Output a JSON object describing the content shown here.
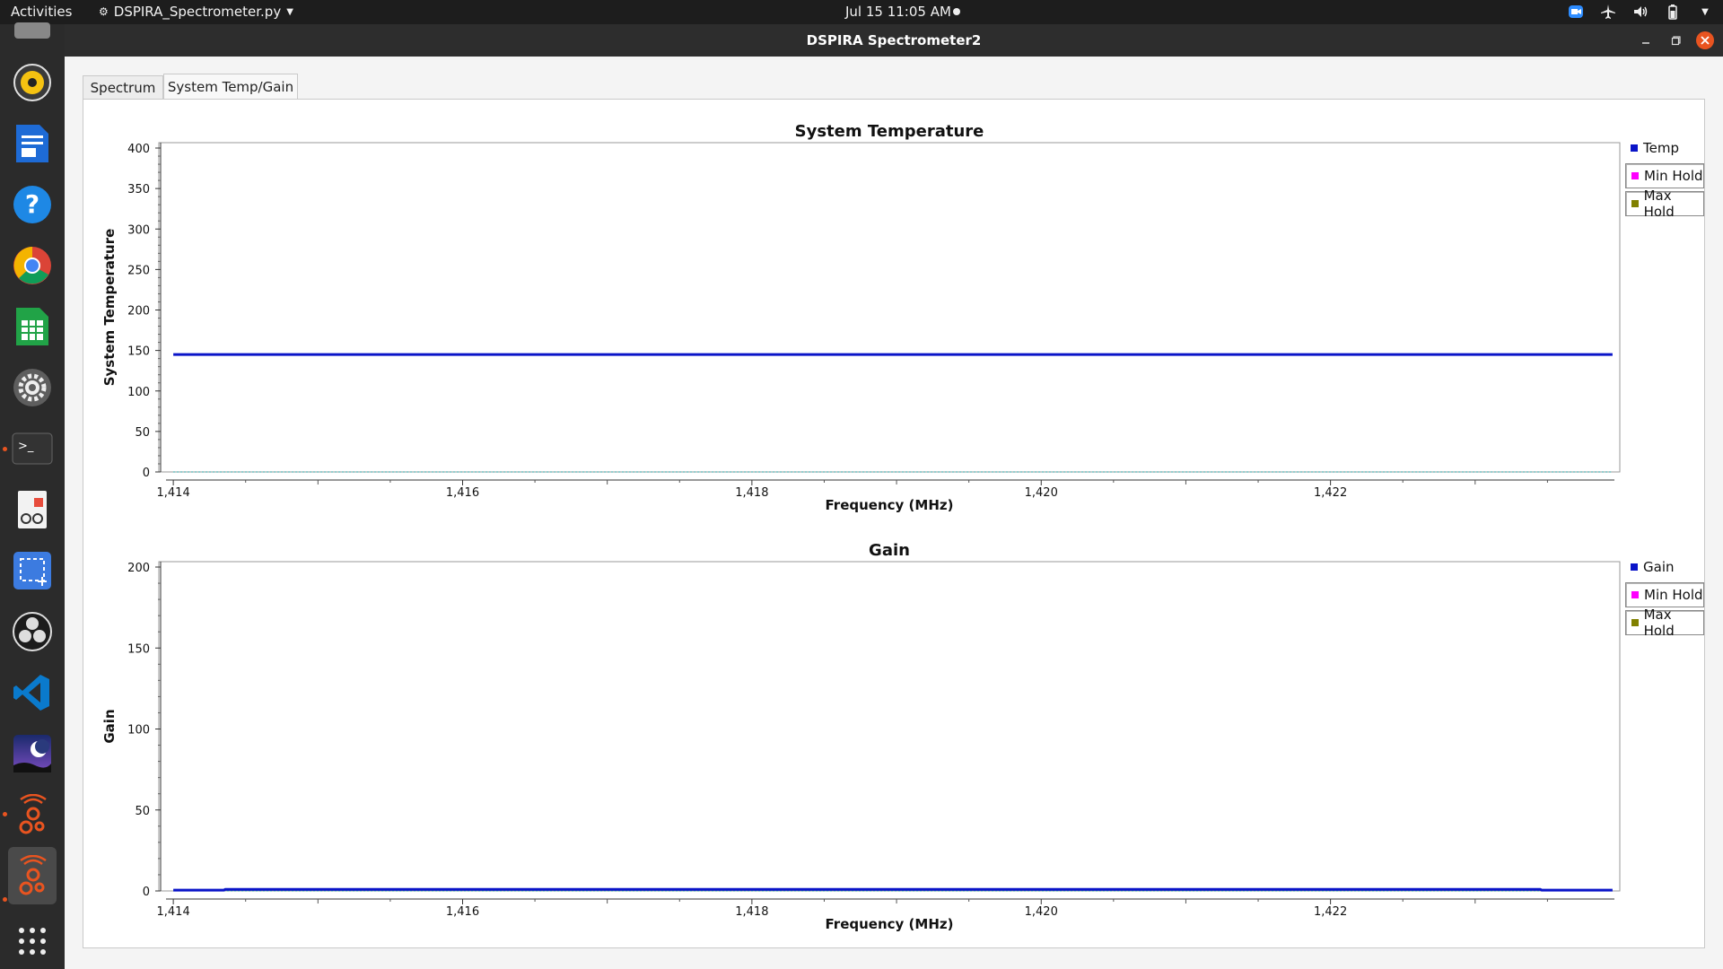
{
  "topbar": {
    "activities": "Activities",
    "app_menu": "DSPIRA_Spectrometer.py",
    "clock": "Jul 15  11:05 AM"
  },
  "dock": {
    "items": [
      "rhythmbox-icon",
      "writer-icon",
      "help-icon",
      "chrome-icon",
      "calc-icon",
      "settings-icon",
      "terminal-icon",
      "document-viewer-icon",
      "screenshot-icon",
      "obs-icon",
      "vscode-icon",
      "stellarium-icon",
      "gnuradio-icon",
      "gnuradio-icon",
      "app-grid-icon"
    ]
  },
  "window": {
    "title": "DSPIRA Spectrometer2",
    "tabs": [
      {
        "label": "Spectrum",
        "active": false
      },
      {
        "label": "System Temp/Gain",
        "active": true
      }
    ]
  },
  "colors": {
    "temp": "#0a14c8",
    "gain": "#0a14c8",
    "min_hold": "#ff00ff",
    "max_hold": "#808000",
    "accent": "#e95420"
  },
  "chart_data": [
    {
      "type": "line",
      "title": "System Temperature",
      "xlabel": "Frequency (MHz)",
      "ylabel": "System Temperature",
      "xlim": [
        1413.9,
        1424.0
      ],
      "ylim": [
        0,
        400
      ],
      "xticks": [
        1414,
        1416,
        1418,
        1420,
        1422
      ],
      "xtick_labels": [
        "1,414",
        "1,416",
        "1,418",
        "1,420",
        "1,422"
      ],
      "yticks": [
        0,
        50,
        100,
        150,
        200,
        250,
        300,
        350,
        400
      ],
      "ytick_labels": [
        "0",
        "50",
        "100",
        "150",
        "200",
        "250",
        "300",
        "350",
        "400"
      ],
      "legend": [
        "Temp",
        "Min Hold",
        "Max Hold"
      ],
      "legend_position": "right",
      "series": [
        {
          "name": "Temp",
          "x": [
            1414,
            1423.95
          ],
          "y": [
            145,
            145
          ]
        },
        {
          "name": "Min Hold",
          "x": [
            1414,
            1423.95
          ],
          "y": [
            0,
            0
          ]
        },
        {
          "name": "Max Hold",
          "x": [
            1414,
            1423.95
          ],
          "y": [
            0,
            0
          ]
        }
      ]
    },
    {
      "type": "line",
      "title": "Gain",
      "xlabel": "Frequency (MHz)",
      "ylabel": "Gain",
      "xlim": [
        1413.9,
        1424.0
      ],
      "ylim": [
        0,
        200
      ],
      "xticks": [
        1414,
        1416,
        1418,
        1420,
        1422
      ],
      "xtick_labels": [
        "1,414",
        "1,416",
        "1,418",
        "1,420",
        "1,422"
      ],
      "yticks": [
        0,
        50,
        100,
        150,
        200
      ],
      "ytick_labels": [
        "0",
        "50",
        "100",
        "150",
        "200"
      ],
      "legend": [
        "Gain",
        "Min Hold",
        "Max Hold"
      ],
      "legend_position": "right",
      "series": [
        {
          "name": "Gain",
          "x": [
            1414,
            1414.35,
            1414.36,
            1423.45,
            1423.46,
            1423.95
          ],
          "y": [
            0.5,
            0.5,
            1,
            1,
            0.5,
            0.5
          ]
        },
        {
          "name": "Min Hold",
          "x": [
            1414,
            1423.95
          ],
          "y": [
            0,
            0
          ]
        },
        {
          "name": "Max Hold",
          "x": [
            1414,
            1423.95
          ],
          "y": [
            0,
            0
          ]
        }
      ]
    }
  ]
}
